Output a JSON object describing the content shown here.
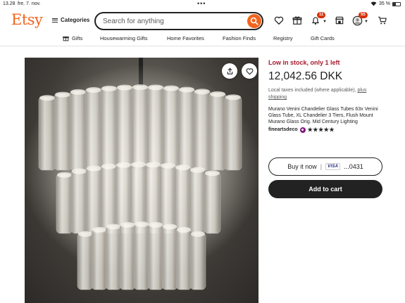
{
  "status_bar": {
    "time": "13.28",
    "date": "fre. 7. nov.",
    "dots": "•••",
    "battery_percent": "35 %"
  },
  "header": {
    "logo": "Etsy",
    "categories_label": "Categories",
    "search_placeholder": "Search for anything",
    "notifications_count": "11",
    "cart_badge_count": "55"
  },
  "nav": {
    "items": [
      {
        "label": "Gifts",
        "icon": "gift-icon"
      },
      {
        "label": "Housewarming Gifts"
      },
      {
        "label": "Home Favorites"
      },
      {
        "label": "Fashion Finds"
      },
      {
        "label": "Registry"
      },
      {
        "label": "Gift Cards"
      }
    ]
  },
  "listing": {
    "stock": "Low in stock, only 1 left",
    "price": "12,042.56 DKK",
    "tax_note": "Local taxes included (where applicable),",
    "tax_link": "plus shipping",
    "title": "Murano Venini Chandelier Glass Tubes 63x Venini Glass Tube, XL Chandelier 3 Tiers, Flush Mount Murano Glass Orig. Mid Century Lighting",
    "shop_name": "fineartsdeco",
    "rating_stars": "★★★★★",
    "rating": 5
  },
  "actions": {
    "buy_now_label": "Buy it now",
    "separator": "|",
    "card_brand": "VISA",
    "card_last4": "...0431",
    "add_to_cart_label": "Add to cart"
  },
  "colors": {
    "brand": "#f1641e",
    "stock_red": "#a61a2e",
    "badge_red": "#d9310b",
    "star_seller_purple": "#7f187f",
    "dark_button": "#222222"
  }
}
